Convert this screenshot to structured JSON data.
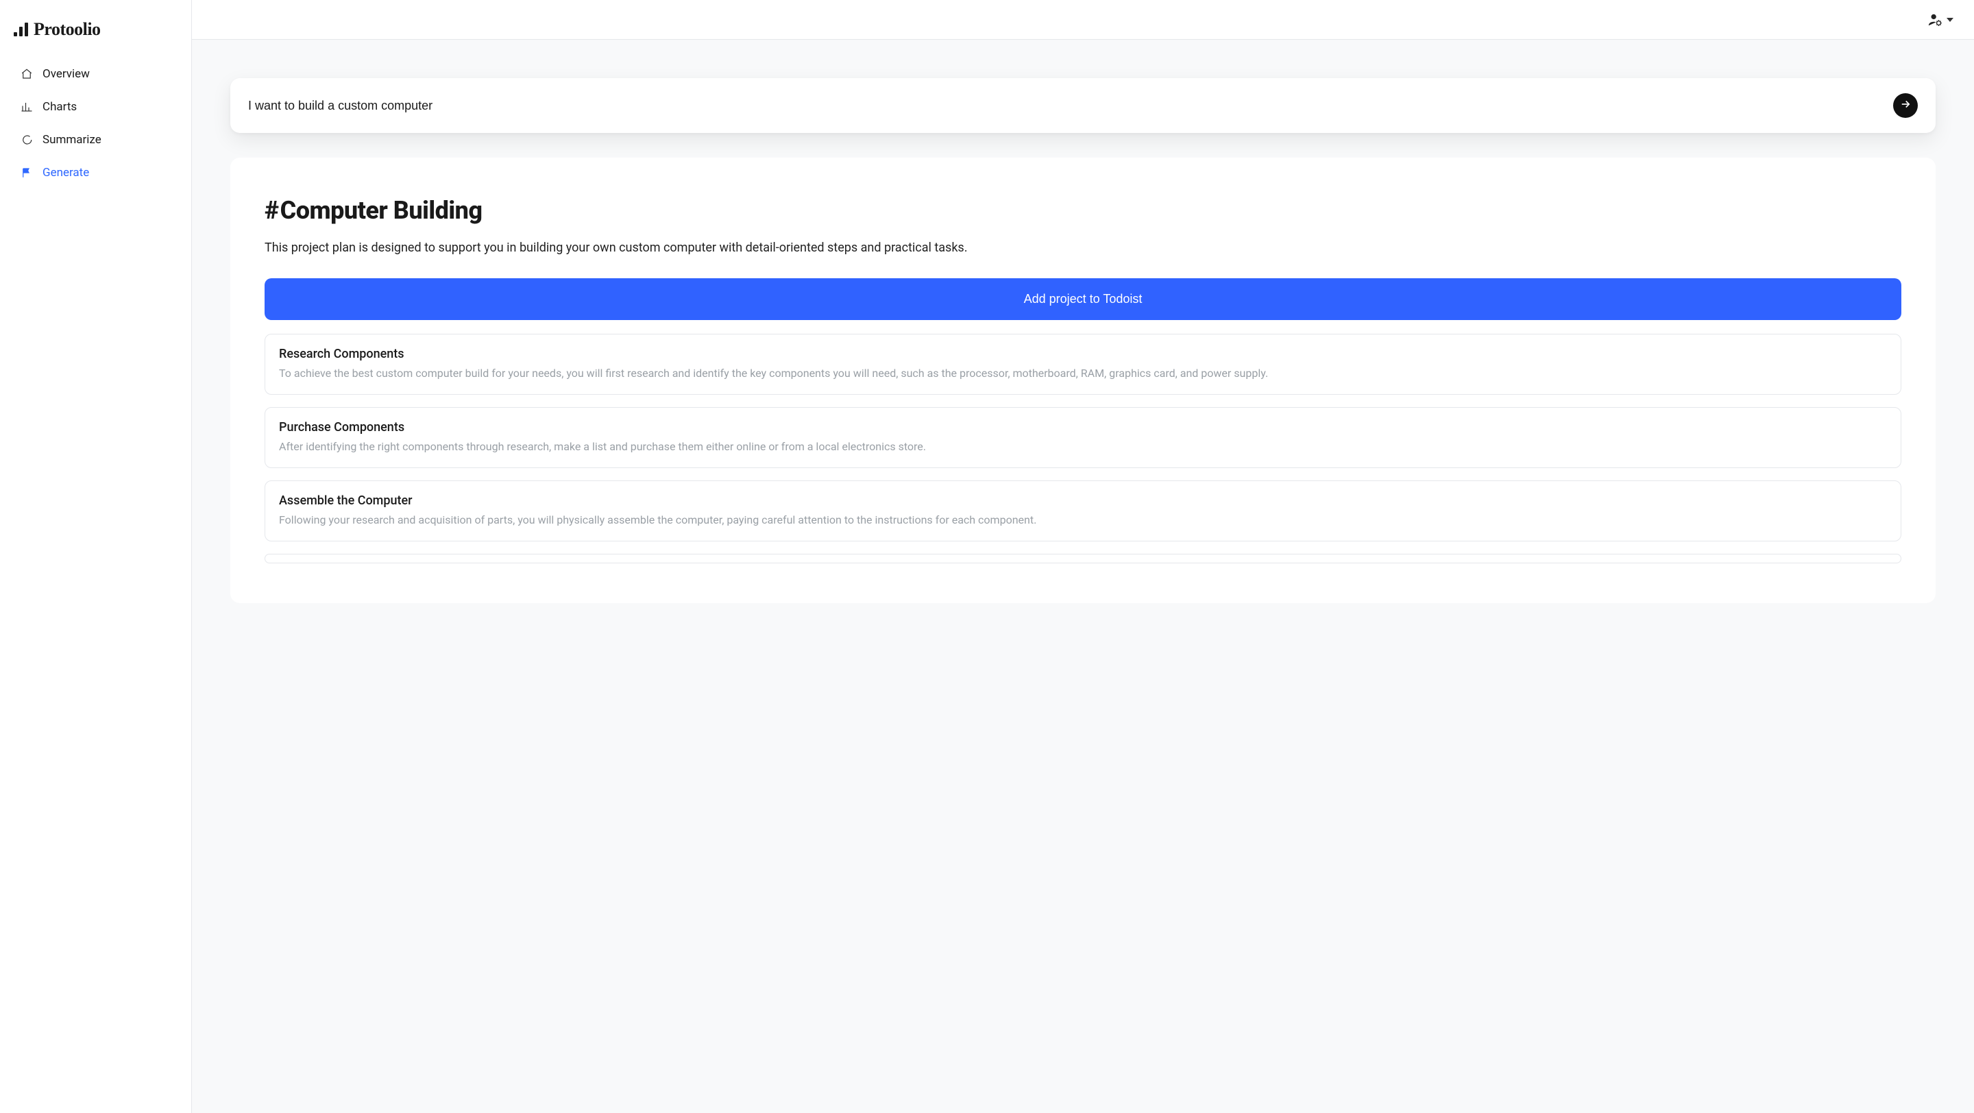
{
  "brand": {
    "name": "Protoolio"
  },
  "sidebar": {
    "items": [
      {
        "label": "Overview",
        "icon": "home-icon",
        "active": false
      },
      {
        "label": "Charts",
        "icon": "bar-chart-icon",
        "active": false
      },
      {
        "label": "Summarize",
        "icon": "chat-icon",
        "active": false
      },
      {
        "label": "Generate",
        "icon": "flag-icon",
        "active": true
      }
    ]
  },
  "prompt": {
    "value": "I want to build a custom computer"
  },
  "project": {
    "title_prefix": "#",
    "title": "Computer Building",
    "description": "This project plan is designed to support you in building your own custom computer with detail-oriented steps and practical tasks.",
    "cta_label": "Add project to Todoist",
    "tasks": [
      {
        "title": "Research Components",
        "body": "To achieve the best custom computer build for your needs, you will first research and identify the key components you will need, such as the processor, motherboard, RAM, graphics card, and power supply."
      },
      {
        "title": "Purchase Components",
        "body": "After identifying the right components through research, make a list and purchase them either online or from a local electronics store."
      },
      {
        "title": "Assemble the Computer",
        "body": "Following your research and acquisition of parts, you will physically assemble the computer, paying careful attention to the instructions for each component."
      }
    ]
  },
  "colors": {
    "primary": "#3062ff",
    "accent": "#2f68ff"
  }
}
